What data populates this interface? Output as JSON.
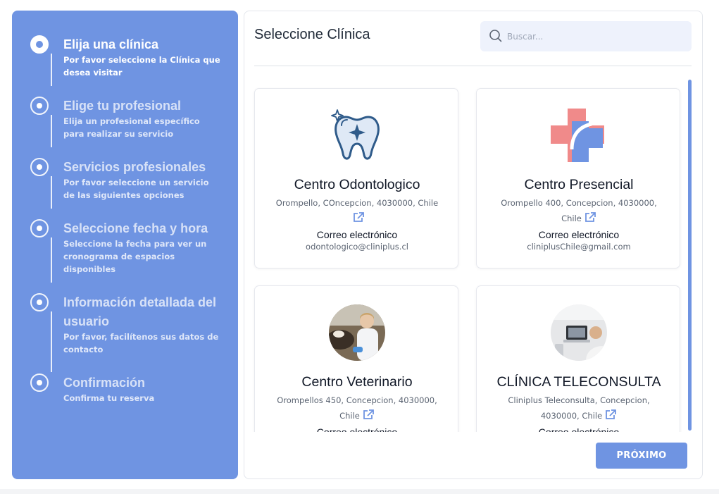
{
  "colors": {
    "accent": "#6f94e2",
    "background": "#ffffff",
    "search_bg": "#eef2fc"
  },
  "steps": [
    {
      "title": "Elija una clínica",
      "desc": "Por favor seleccione la Clínica que desea visitar",
      "state": "active"
    },
    {
      "title": "Elige tu profesional",
      "desc": "Elija un profesional específico para realizar su servicio",
      "state": "inactive"
    },
    {
      "title": "Servicios profesionales",
      "desc": "Por favor seleccione un servicio de las siguientes opciones",
      "state": "inactive"
    },
    {
      "title": "Seleccione fecha y hora",
      "desc": "Seleccione la fecha para ver un cronograma de espacios disponibles",
      "state": "inactive"
    },
    {
      "title": "Información detallada del usuario",
      "desc": "Por favor, facilítenos sus datos de contacto",
      "state": "inactive"
    },
    {
      "title": "Confirmación",
      "desc": "Confirma tu reserva",
      "state": "inactive"
    }
  ],
  "main": {
    "title": "Seleccione Clínica",
    "search_placeholder": "Buscar...",
    "next_label": "PRÓXIMO"
  },
  "clinics": [
    {
      "name": "Centro Odontologico",
      "address": "Orompello, COncepcion, 4030000, Chile",
      "email_label": "Correo electrónico",
      "email": "odontologico@cliniplus.cl",
      "image": "tooth-icon"
    },
    {
      "name": "Centro Presencial",
      "address": "Orompello 400, Concepcion, 4030000, Chile",
      "email_label": "Correo electrónico",
      "email": "cliniplusChile@gmail.com",
      "image": "medical-cross-icon"
    },
    {
      "name": "Centro Veterinario",
      "address": "Orompellos 450, Concepcion, 4030000, Chile",
      "email_label": "Correo electrónico",
      "email": "",
      "image": "vet-photo"
    },
    {
      "name": "CLÍNICA TELECONSULTA",
      "address": "Cliniplus Teleconsulta, Concepcion, 4030000, Chile",
      "email_label": "Correo electrónico",
      "email": "",
      "image": "teleconsult-photo"
    }
  ]
}
